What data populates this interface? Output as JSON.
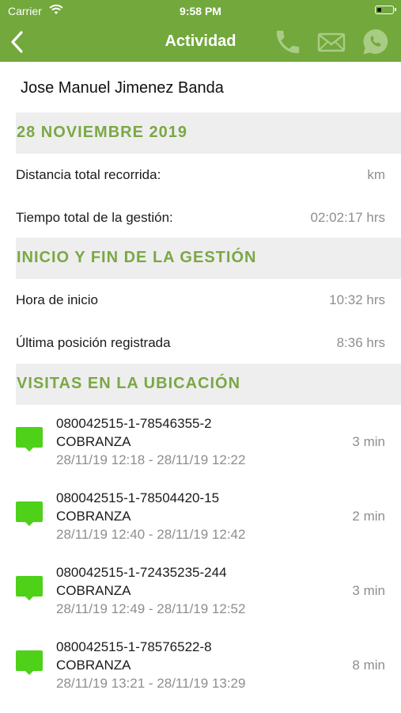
{
  "status_bar": {
    "carrier": "Carrier",
    "time": "9:58 PM"
  },
  "nav": {
    "title": "Actividad"
  },
  "agent": {
    "name": "Jose Manuel Jimenez Banda"
  },
  "summary": {
    "date_header": "28 NOVIEMBRE 2019",
    "distance_label": "Distancia total recorrida:",
    "distance_value": "km",
    "time_label": "Tiempo total de la gestión:",
    "time_value": "02:02:17 hrs"
  },
  "session": {
    "header": "INICIO Y FIN DE LA GESTIÓN",
    "start_label": "Hora de inicio",
    "start_value": "10:32 hrs",
    "last_label": "Última posición registrada",
    "last_value": "8:36 hrs"
  },
  "visits": {
    "header": "VISITAS EN LA UBICACIÓN",
    "items": [
      {
        "code": "080042515-1-78546355-2",
        "type": "COBRANZA",
        "range": "28/11/19 12:18 - 28/11/19 12:22",
        "duration": "3 min"
      },
      {
        "code": "080042515-1-78504420-15",
        "type": "COBRANZA",
        "range": "28/11/19 12:40 - 28/11/19 12:42",
        "duration": "2 min"
      },
      {
        "code": "080042515-1-72435235-244",
        "type": "COBRANZA",
        "range": "28/11/19 12:49 - 28/11/19 12:52",
        "duration": "3 min"
      },
      {
        "code": "080042515-1-78576522-8",
        "type": "COBRANZA",
        "range": "28/11/19 13:21 - 28/11/19 13:29",
        "duration": "8 min"
      }
    ]
  },
  "icons": {
    "back": "chevron-left-icon",
    "phone": "phone-icon",
    "mail": "mail-icon",
    "whatsapp": "whatsapp-icon",
    "visit": "chat-bubble-icon",
    "wifi": "wifi-icon",
    "battery": "battery-icon"
  },
  "colors": {
    "brand": "#72a83c",
    "section_text": "#7aa845",
    "visit_icon": "#4fd11a",
    "nav_icons": "#a9cc85"
  }
}
